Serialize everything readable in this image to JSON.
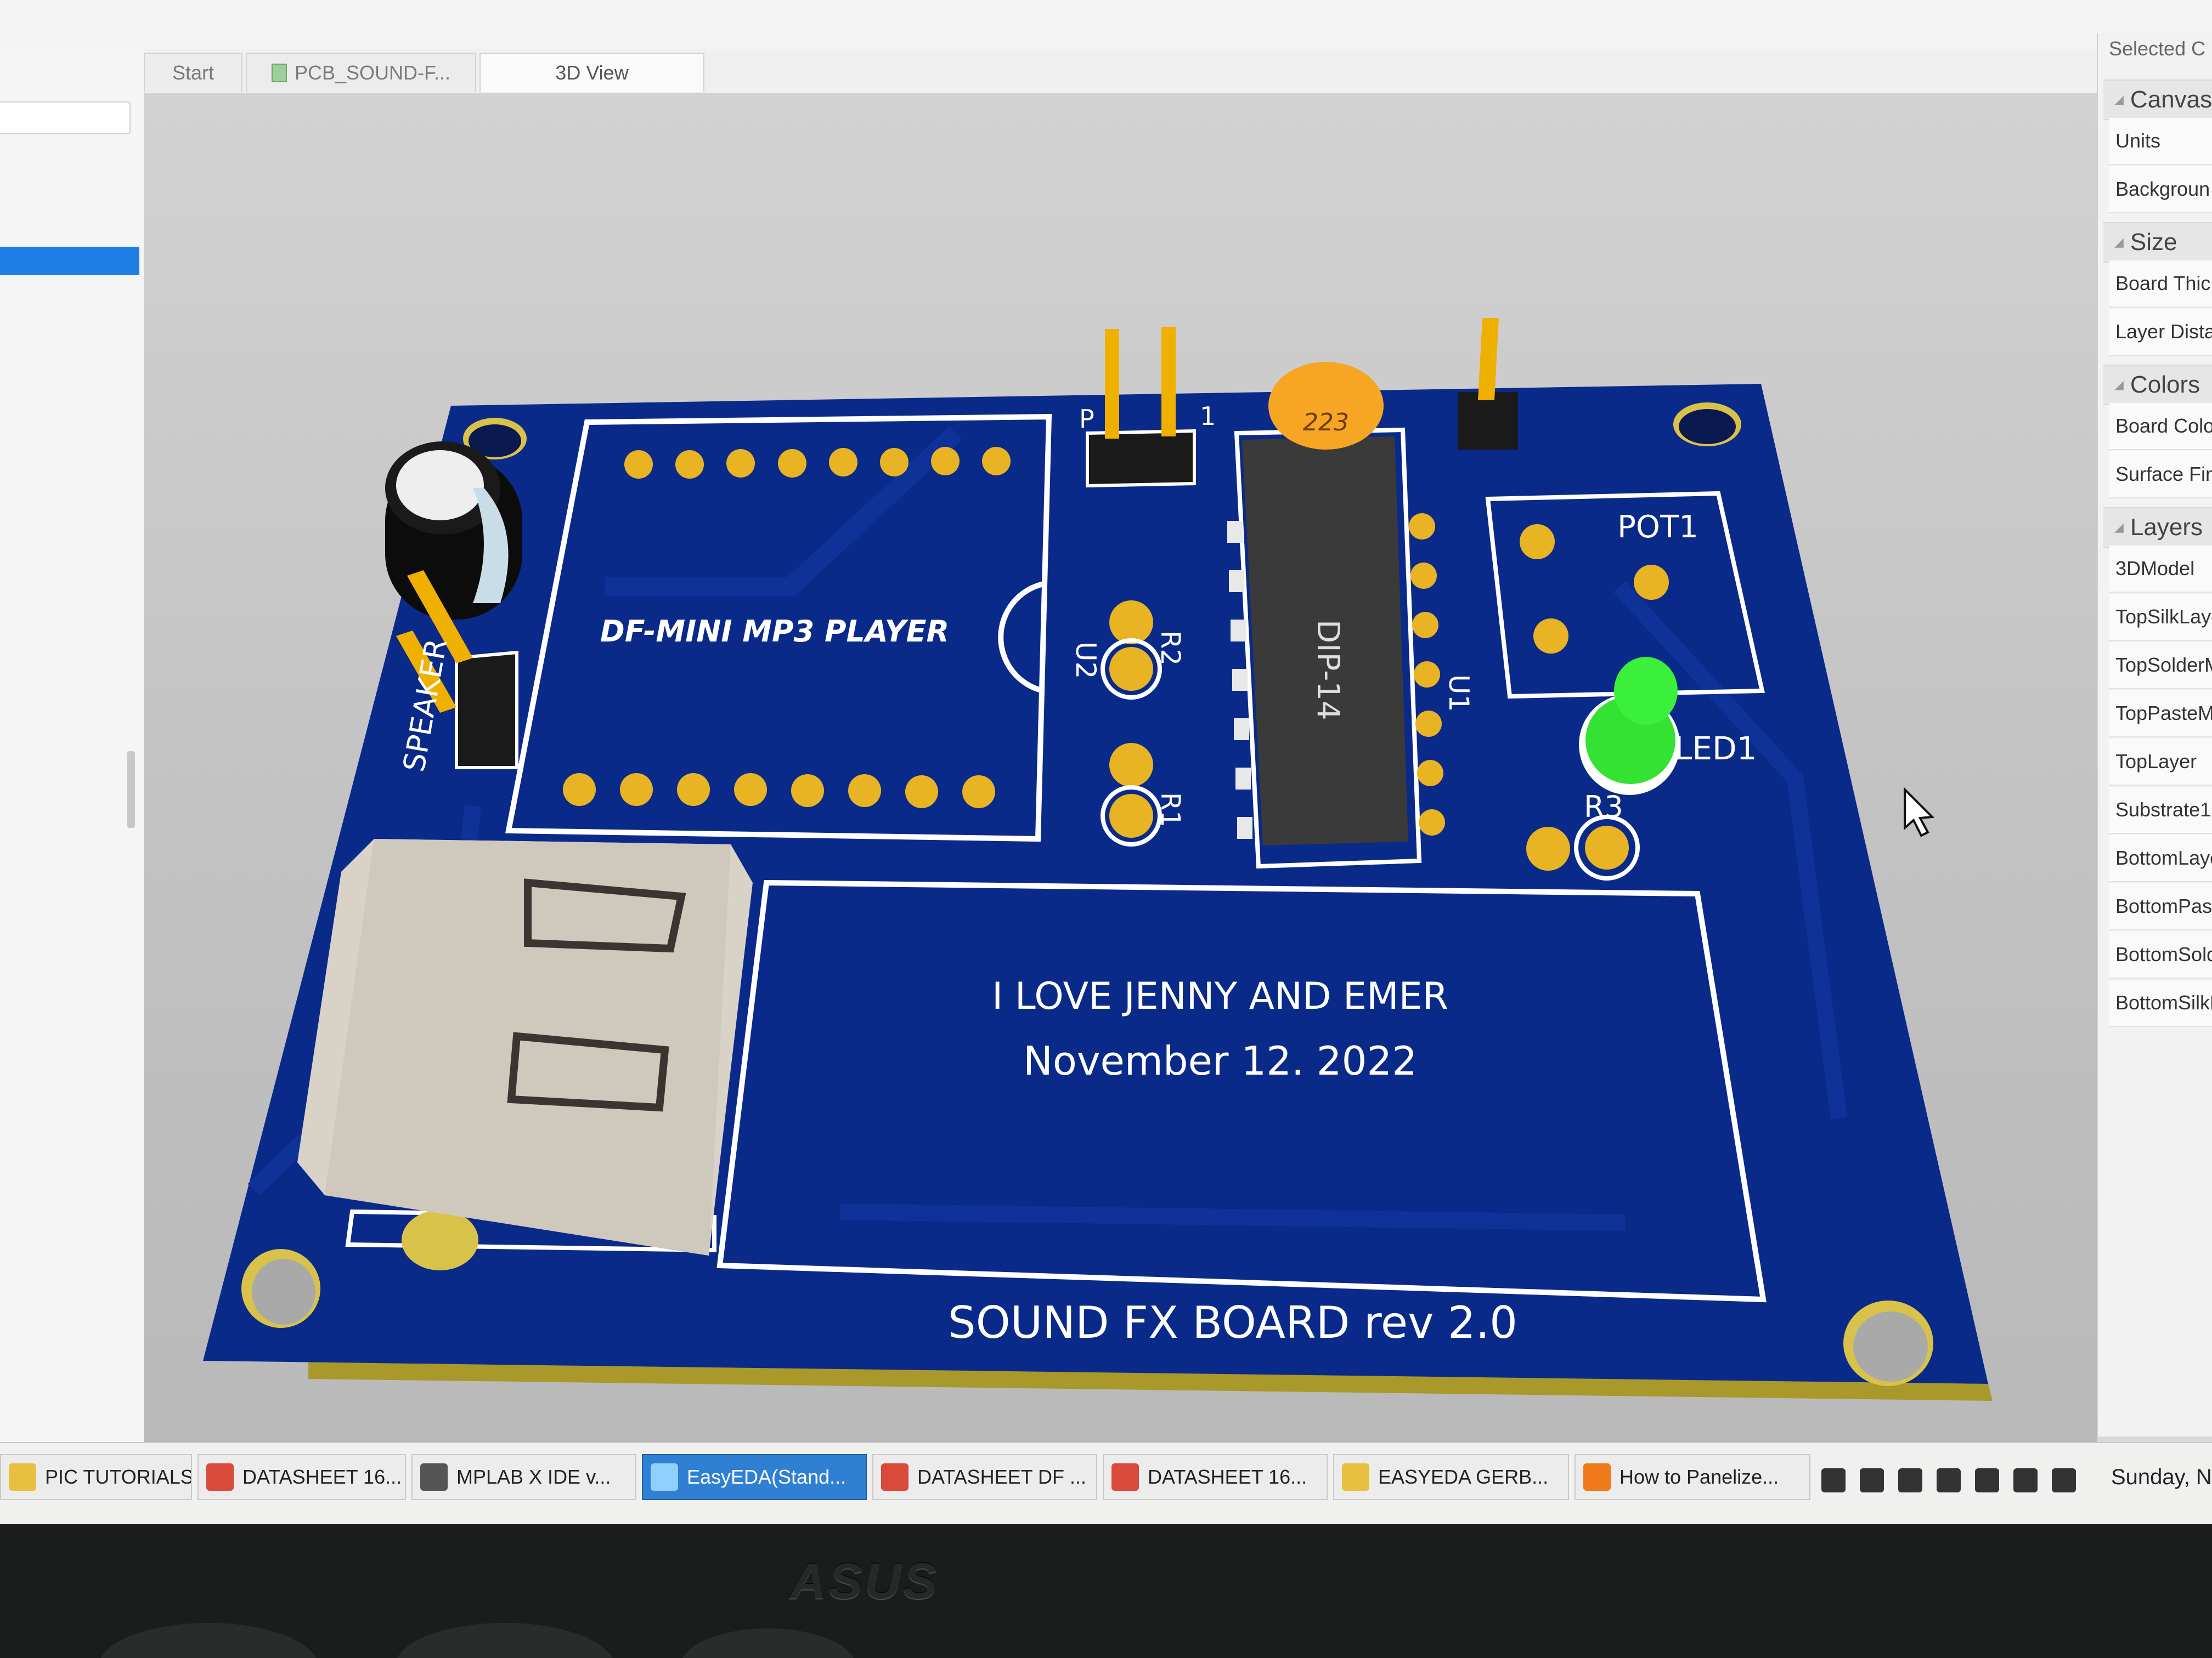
{
  "tabs": [
    {
      "label": "Start"
    },
    {
      "label": "PCB_SOUND-F..."
    },
    {
      "label": "3D View"
    }
  ],
  "right_panel": {
    "header": "Selected C",
    "sections": [
      {
        "title": "Canvas",
        "rows": [
          "Units",
          "Backgroun"
        ]
      },
      {
        "title": "Size",
        "rows": [
          "Board Thic",
          "Layer Dista"
        ]
      },
      {
        "title": "Colors",
        "rows": [
          "Board Colo",
          "Surface Fin"
        ]
      },
      {
        "title": "Layers",
        "rows": [
          "3DModel",
          "TopSilkLaye",
          "TopSolderM",
          "TopPasteMa",
          "TopLayer",
          "Substrate1",
          "BottomLaye",
          "BottomPast",
          "BottomSolde",
          "BottomSilkL"
        ]
      }
    ]
  },
  "board": {
    "silk_labels": {
      "mp3": "DF-MINI MP3 PLAYER",
      "u2": "U2",
      "r2": "R2",
      "r1": "R1",
      "dip": "DIP-14",
      "u1": "U1",
      "pot": "POT1",
      "led": "LED1",
      "r3": "R3",
      "spk": "SPEAKER",
      "p1": "P",
      "p1b": "1",
      "cap_code": "223",
      "line1": "I LOVE JENNY AND EMER",
      "line2": "November 12. 2022",
      "footer": "SOUND FX BOARD rev 2.0"
    }
  },
  "taskbar": {
    "items": [
      {
        "label": "PIC TUTORIALS...",
        "icon": "folder-icon"
      },
      {
        "label": "DATASHEET 16...",
        "icon": "pdf-icon"
      },
      {
        "label": "MPLAB X IDE v...",
        "icon": "mplab-icon"
      },
      {
        "label": "EasyEDA(Stand...",
        "icon": "easyeda-icon",
        "active": true
      },
      {
        "label": "DATASHEET DF ...",
        "icon": "pdf-icon"
      },
      {
        "label": "DATASHEET 16...",
        "icon": "pdf-icon"
      },
      {
        "label": "EASYEDA GERB...",
        "icon": "folder-icon"
      },
      {
        "label": "How to Panelize...",
        "icon": "firefox-icon"
      }
    ],
    "clock": "Sunday, N"
  },
  "bezel": {
    "brand": "ASUS"
  },
  "colors": {
    "board": "#0a2a8a",
    "silk": "#ffffff",
    "pad": "#e8b423",
    "active_task": "#2f7fd3",
    "selection": "#1e7ee6"
  }
}
